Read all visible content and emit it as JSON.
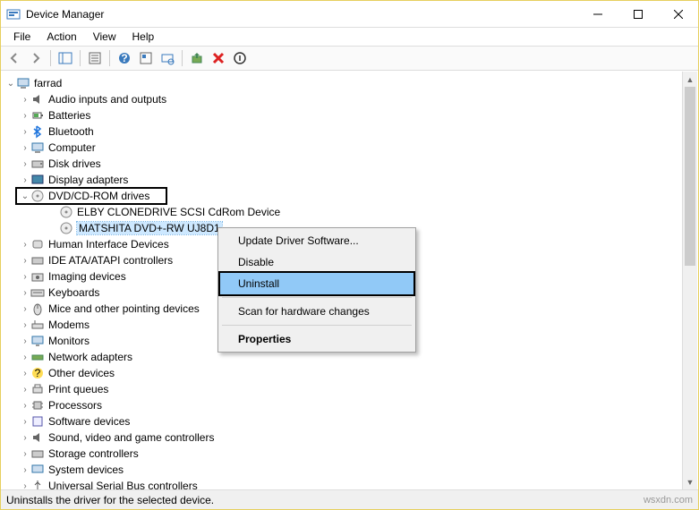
{
  "window": {
    "title": "Device Manager"
  },
  "menu": {
    "file": "File",
    "action": "Action",
    "view": "View",
    "help": "Help"
  },
  "tree": {
    "root": "farrad",
    "items": [
      "Audio inputs and outputs",
      "Batteries",
      "Bluetooth",
      "Computer",
      "Disk drives",
      "Display adapters",
      "DVD/CD-ROM drives",
      "Human Interface Devices",
      "IDE ATA/ATAPI controllers",
      "Imaging devices",
      "Keyboards",
      "Mice and other pointing devices",
      "Modems",
      "Monitors",
      "Network adapters",
      "Other devices",
      "Print queues",
      "Processors",
      "Software devices",
      "Sound, video and game controllers",
      "Storage controllers",
      "System devices",
      "Universal Serial Bus controllers"
    ],
    "dvd_children": [
      "ELBY CLONEDRIVE SCSI CdRom Device",
      "MATSHITA DVD+-RW UJ8D1"
    ]
  },
  "context": {
    "update": "Update Driver Software...",
    "disable": "Disable",
    "uninstall": "Uninstall",
    "scan": "Scan for hardware changes",
    "properties": "Properties"
  },
  "status": "Uninstalls the driver for the selected device.",
  "watermark": "wsxdn.com"
}
